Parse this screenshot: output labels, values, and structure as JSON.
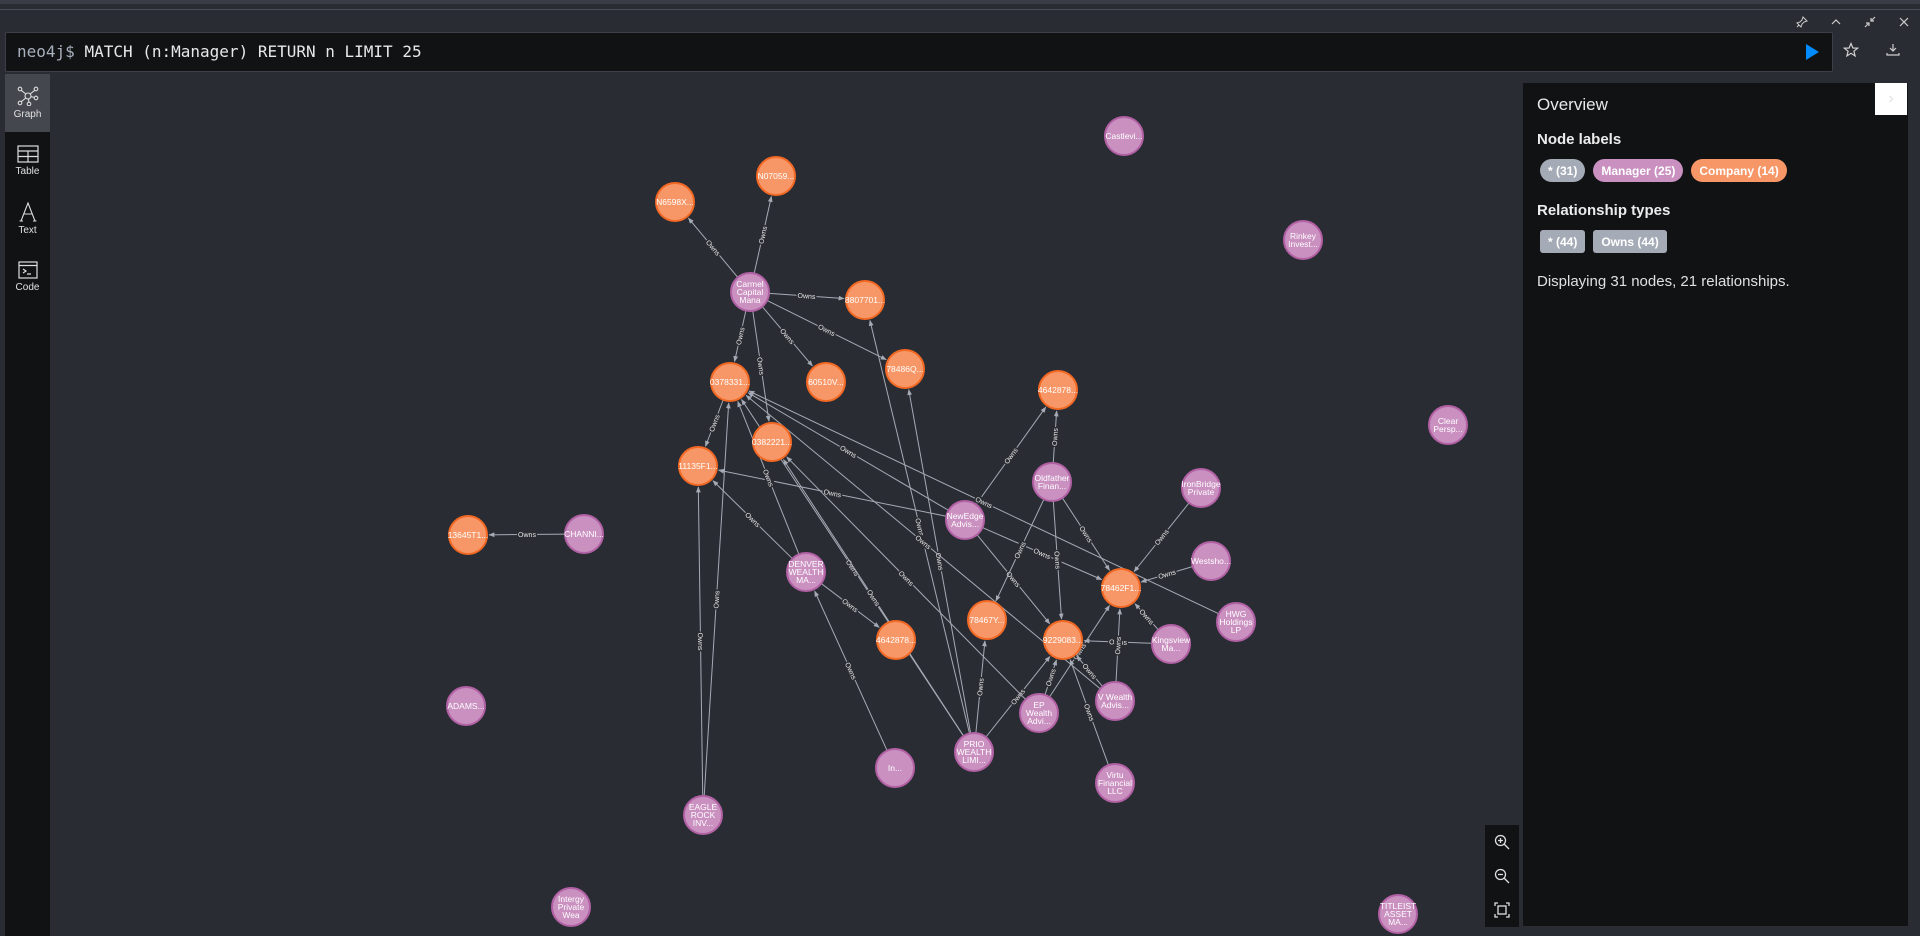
{
  "window": {
    "controls": [
      "pin-icon",
      "chevron-up-icon",
      "collapse-icon",
      "close-icon"
    ]
  },
  "editor": {
    "prompt": "neo4j$",
    "query": "MATCH (n:Manager) RETURN n LIMIT 25"
  },
  "sidebar": {
    "items": [
      {
        "label": "Graph",
        "icon": "graph-icon",
        "active": true
      },
      {
        "label": "Table",
        "icon": "table-icon",
        "active": false
      },
      {
        "label": "Text",
        "icon": "text-icon",
        "active": false
      },
      {
        "label": "Code",
        "icon": "code-icon",
        "active": false
      }
    ]
  },
  "overview": {
    "title": "Overview",
    "node_labels_heading": "Node labels",
    "node_labels": [
      {
        "label": "* (31)",
        "color": "#a5abb6"
      },
      {
        "label": "Manager (25)",
        "color": "#c990c0"
      },
      {
        "label": "Company (14)",
        "color": "#f79767"
      }
    ],
    "rel_types_heading": "Relationship types",
    "rel_types": [
      {
        "label": "* (44)",
        "color": "#a5abb6"
      },
      {
        "label": "Owns (44)",
        "color": "#a5abb6"
      }
    ],
    "status": "Displaying 31 nodes, 21 relationships."
  },
  "colors": {
    "manager_fill": "#c990c0",
    "manager_stroke": "#b261a5",
    "company_fill": "#f79767",
    "company_stroke": "#f36924",
    "edge": "#a5abb6",
    "run": "#018bff"
  },
  "graph": {
    "rel_label": "Owns",
    "nodes": [
      {
        "id": "castlevi",
        "type": "Manager",
        "lines": [
          "Castlevi..."
        ]
      },
      {
        "id": "rinkey",
        "type": "Manager",
        "lines": [
          "Rinkey",
          "Invest..."
        ]
      },
      {
        "id": "clear",
        "type": "Manager",
        "lines": [
          "Clear",
          "Persp..."
        ]
      },
      {
        "id": "n6598",
        "type": "Company",
        "lines": [
          "N6598X..."
        ]
      },
      {
        "id": "n0705",
        "type": "Company",
        "lines": [
          "N07059..."
        ]
      },
      {
        "id": "carmel",
        "type": "Manager",
        "lines": [
          "Carmel",
          "Capital",
          "Mana"
        ]
      },
      {
        "id": "c8807",
        "type": "Company",
        "lines": [
          "8807701..."
        ]
      },
      {
        "id": "c78486",
        "type": "Company",
        "lines": [
          "78486Q..."
        ]
      },
      {
        "id": "c60510",
        "type": "Company",
        "lines": [
          "60510V..."
        ]
      },
      {
        "id": "c0378",
        "type": "Company",
        "lines": [
          "0378331..."
        ]
      },
      {
        "id": "c0382",
        "type": "Company",
        "lines": [
          "0382221..."
        ]
      },
      {
        "id": "c11135",
        "type": "Company",
        "lines": [
          "11135F1..."
        ]
      },
      {
        "id": "c4642a",
        "type": "Company",
        "lines": [
          "4642878..."
        ]
      },
      {
        "id": "oldfather",
        "type": "Manager",
        "lines": [
          "Oldfather",
          "Finan..."
        ]
      },
      {
        "id": "ironbridge",
        "type": "Manager",
        "lines": [
          "IronBridge",
          "Private"
        ]
      },
      {
        "id": "newedge",
        "type": "Manager",
        "lines": [
          "NewEdge",
          "Advis..."
        ]
      },
      {
        "id": "c13645",
        "type": "Company",
        "lines": [
          "13645T1..."
        ]
      },
      {
        "id": "channi",
        "type": "Manager",
        "lines": [
          "CHANNI..."
        ]
      },
      {
        "id": "westsho",
        "type": "Manager",
        "lines": [
          "Westsho..."
        ]
      },
      {
        "id": "denver",
        "type": "Manager",
        "lines": [
          "DENVER",
          "WEALTH",
          "MA..."
        ]
      },
      {
        "id": "c78462",
        "type": "Company",
        "lines": [
          "78462F1..."
        ]
      },
      {
        "id": "hwg",
        "type": "Manager",
        "lines": [
          "HWG",
          "Holdings",
          "LP"
        ]
      },
      {
        "id": "c78467",
        "type": "Company",
        "lines": [
          "78467Y..."
        ]
      },
      {
        "id": "c4642b",
        "type": "Company",
        "lines": [
          "4642878..."
        ]
      },
      {
        "id": "c9229",
        "type": "Company",
        "lines": [
          "9229083..."
        ]
      },
      {
        "id": "kingsview",
        "type": "Manager",
        "lines": [
          "Kingsview",
          "Ma..."
        ]
      },
      {
        "id": "adams",
        "type": "Manager",
        "lines": [
          "ADAMS..."
        ]
      },
      {
        "id": "vwealth",
        "type": "Manager",
        "lines": [
          "V Wealth",
          "Advis..."
        ]
      },
      {
        "id": "epwealth",
        "type": "Manager",
        "lines": [
          "EP",
          "Wealth",
          "Advi..."
        ]
      },
      {
        "id": "prio",
        "type": "Manager",
        "lines": [
          "PRIO",
          "WEALTH",
          "LIMI..."
        ]
      },
      {
        "id": "in",
        "type": "Manager",
        "lines": [
          "In..."
        ]
      },
      {
        "id": "virtu",
        "type": "Manager",
        "lines": [
          "Virtu",
          "Financial",
          "LLC"
        ]
      },
      {
        "id": "eagle",
        "type": "Manager",
        "lines": [
          "EAGLE",
          "ROCK",
          "INV..."
        ]
      },
      {
        "id": "intergy",
        "type": "Manager",
        "lines": [
          "Intergy",
          "Private",
          "Wea"
        ]
      },
      {
        "id": "titleist",
        "type": "Manager",
        "lines": [
          "TITLEIST",
          "ASSET",
          "MA..."
        ]
      }
    ],
    "edges": [
      [
        "carmel",
        "n6598"
      ],
      [
        "carmel",
        "n0705"
      ],
      [
        "carmel",
        "c8807"
      ],
      [
        "carmel",
        "c78486"
      ],
      [
        "carmel",
        "c60510"
      ],
      [
        "carmel",
        "c0378"
      ],
      [
        "carmel",
        "c0382"
      ],
      [
        "channi",
        "c13645"
      ],
      [
        "c0378",
        "c11135"
      ],
      [
        "oldfather",
        "c4642a"
      ],
      [
        "newedge",
        "c4642a"
      ],
      [
        "newedge",
        "c0378"
      ],
      [
        "newedge",
        "c11135"
      ],
      [
        "newedge",
        "c9229"
      ],
      [
        "newedge",
        "c78462"
      ],
      [
        "oldfather",
        "c78467"
      ],
      [
        "oldfather",
        "c9229"
      ],
      [
        "oldfather",
        "c78462"
      ],
      [
        "ironbridge",
        "c78462"
      ],
      [
        "westsho",
        "c78462"
      ],
      [
        "hwg",
        "c0378"
      ],
      [
        "kingsview",
        "c78462"
      ],
      [
        "kingsview",
        "c9229"
      ],
      [
        "denver",
        "c0378"
      ],
      [
        "denver",
        "c4642b"
      ],
      [
        "denver",
        "c11135"
      ],
      [
        "eagle",
        "c11135"
      ],
      [
        "eagle",
        "c0378"
      ],
      [
        "prio",
        "c8807"
      ],
      [
        "prio",
        "c78486"
      ],
      [
        "prio",
        "c78467"
      ],
      [
        "prio",
        "c9229"
      ],
      [
        "prio",
        "c0378"
      ],
      [
        "prio",
        "c0382"
      ],
      [
        "epwealth",
        "c9229"
      ],
      [
        "epwealth",
        "c78462"
      ],
      [
        "epwealth",
        "c0382"
      ],
      [
        "vwealth",
        "c9229"
      ],
      [
        "vwealth",
        "c78462"
      ],
      [
        "vwealth",
        "c0378"
      ],
      [
        "virtu",
        "c9229"
      ],
      [
        "in",
        "denver"
      ]
    ]
  },
  "zoom_controls": [
    "zoom-in-icon",
    "zoom-out-icon",
    "fit-to-screen-icon"
  ]
}
